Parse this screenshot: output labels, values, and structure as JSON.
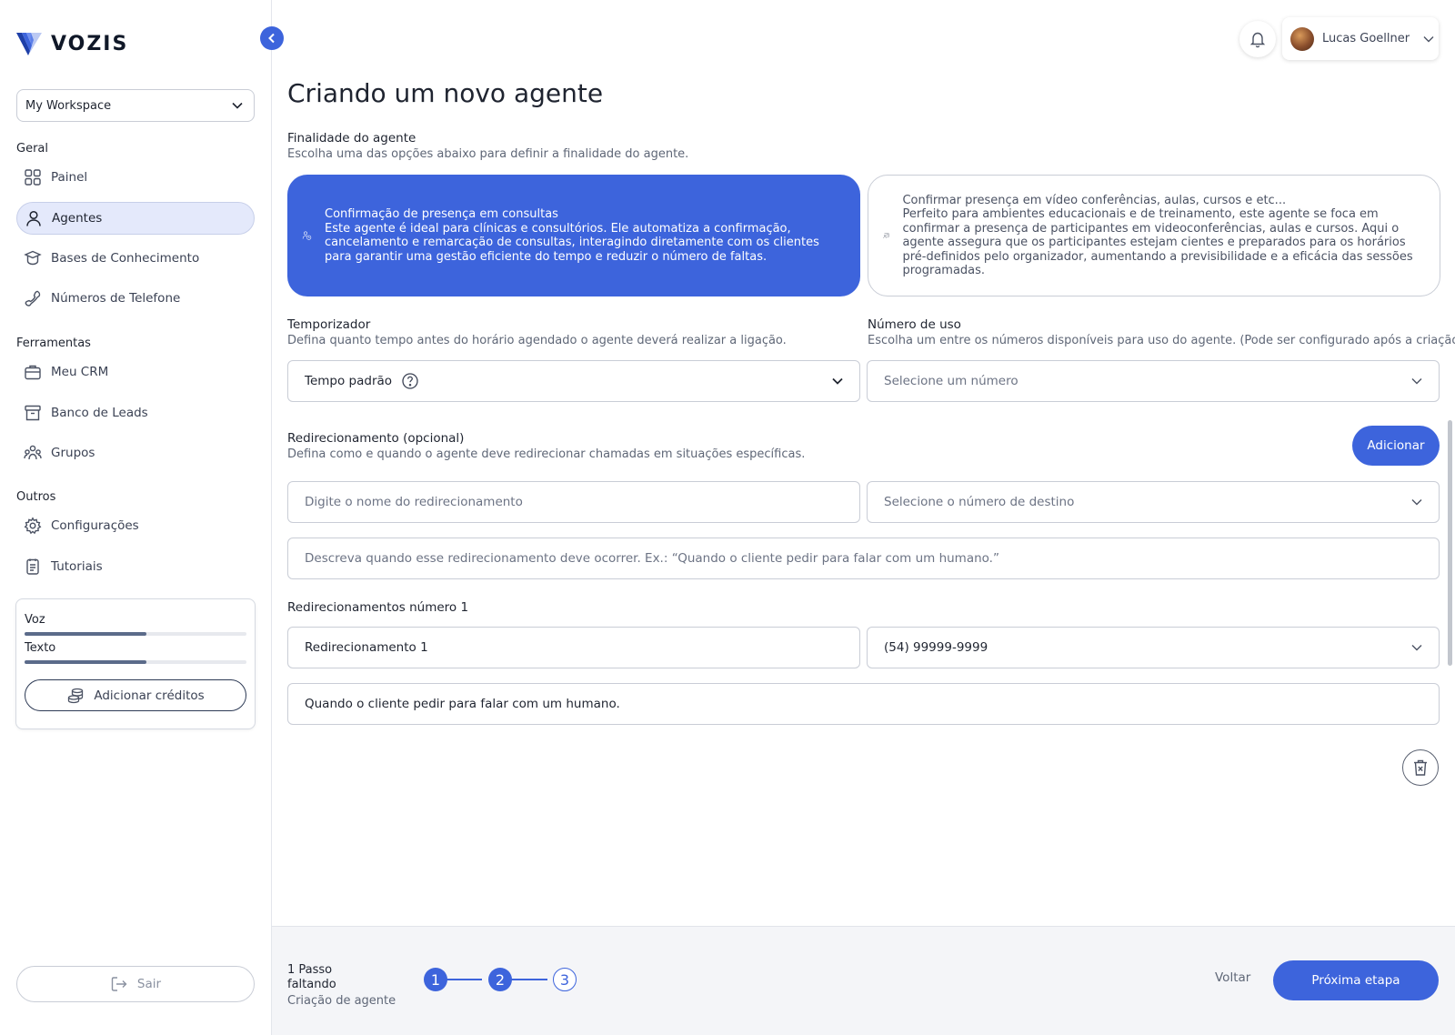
{
  "brand": {
    "name": "VOZIS",
    "accent": "#3d64dc"
  },
  "sidebar": {
    "workspace": "My Workspace",
    "sections": {
      "geral": "Geral",
      "ferramentas": "Ferramentas",
      "outros": "Outros"
    },
    "items": [
      {
        "label": "Painel",
        "icon": "grid-icon"
      },
      {
        "label": "Agentes",
        "icon": "user-icon",
        "active": true
      },
      {
        "label": "Bases de Conhecimento",
        "icon": "database-icon"
      },
      {
        "label": "Números de Telefone",
        "icon": "phone-icon"
      },
      {
        "label": "Meu CRM",
        "icon": "briefcase-icon"
      },
      {
        "label": "Banco de Leads",
        "icon": "archive-icon"
      },
      {
        "label": "Grupos",
        "icon": "users-icon"
      },
      {
        "label": "Configurações",
        "icon": "gear-icon"
      },
      {
        "label": "Tutoriais",
        "icon": "document-icon"
      }
    ],
    "credits": {
      "voice_label": "Voz",
      "voice_fraction": 0.55,
      "text_label": "Texto",
      "text_fraction": 0.55,
      "add_label": "Adicionar créditos"
    },
    "logout_label": "Sair"
  },
  "header": {
    "user_name": "Lucas Goellner"
  },
  "main": {
    "title": "Criando um novo agente",
    "purpose": {
      "title": "Finalidade do agente",
      "subtitle": "Escolha uma das opções abaixo para definir a finalidade do agente.",
      "options": [
        {
          "title": "Confirmação de presença em consultas",
          "description": "Este agente é ideal para clínicas e consultórios. Ele automatiza a confirmação, cancelamento e remarcação de consultas, interagindo diretamente com os clientes para garantir uma gestão eficiente do tempo e reduzir o número de faltas.",
          "selected": true
        },
        {
          "title": "Confirmar presença em vídeo conferências, aulas, cursos e etc...",
          "description": "Perfeito para ambientes educacionais e de treinamento, este agente se foca em confirmar a presença de participantes em videoconferências, aulas e cursos. Aqui o agente assegura que os participantes estejam cientes e preparados para os horários pré-definidos pelo organizador, aumentando a previsibilidade e a eficácia das sessões programadas.",
          "selected": false
        }
      ]
    },
    "timer": {
      "title": "Temporizador",
      "subtitle": "Defina quanto tempo antes do horário agendado o agente deverá realizar a ligação.",
      "value": "Tempo padrão"
    },
    "usage_number": {
      "title": "Número de uso",
      "subtitle": "Escolha um entre os números disponíveis para uso do agente. (Pode ser configurado após a criação)",
      "placeholder": "Selecione um número"
    },
    "redirect": {
      "title": "Redirecionamento (opcional)",
      "subtitle": "Defina como e quando o agente deve redirecionar chamadas em situações específicas.",
      "add_label": "Adicionar",
      "name_placeholder": "Digite o nome do redirecionamento",
      "destination_placeholder": "Selecione o número de destino",
      "description_placeholder": "Descreva quando esse redirecionamento deve ocorrer. Ex.: “Quando o cliente pedir para falar com um humano.”"
    },
    "redirect_list": {
      "title": "Redirecionamentos número 1",
      "items": [
        {
          "name": "Redirecionamento 1",
          "number": "(54) 99999-9999",
          "description": "Quando o cliente pedir para falar com um humano."
        }
      ]
    }
  },
  "footer": {
    "steps_left": "1 Passo",
    "steps_left_suffix": "faltando",
    "step_name": "Criação de agente",
    "steps": [
      "1",
      "2",
      "3"
    ],
    "current_step": 2,
    "back_label": "Voltar",
    "next_label": "Próxima etapa"
  }
}
